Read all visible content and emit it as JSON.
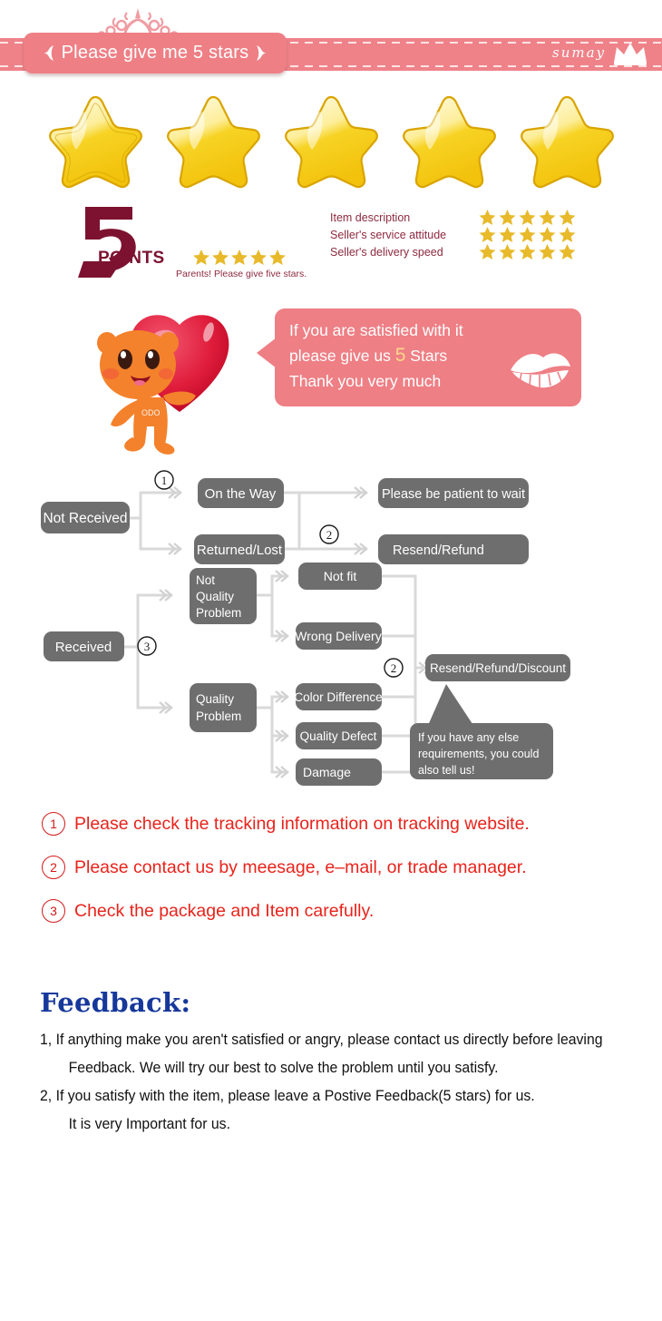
{
  "header": {
    "banner_title": "Please give me 5 stars",
    "brand_name": "sumay",
    "crown_icon": "crown-deco-icon",
    "left_ornament_icon": "ornament-icon",
    "right_ornament_icon": "ornament-icon",
    "brand_crown_icon": "crown-icon",
    "banner_color": "#ef8289",
    "plate_color": "#ee7f85"
  },
  "big_stars": {
    "count": 5,
    "star_icon": "gold-star-icon",
    "color": "#f5cf1e"
  },
  "points": {
    "number": "5",
    "label": "POINTS",
    "subtitle": "Parents! Please give five stars.",
    "star_count": 5,
    "color": "#7d1230",
    "star_color": "#e8b92a"
  },
  "rating_rows": [
    {
      "name": "Item description",
      "stars": 5
    },
    {
      "name": "Seller's service attitude",
      "stars": 5
    },
    {
      "name": "Seller's delivery speed",
      "stars": 5
    }
  ],
  "promo": {
    "mascot_icon": "mascot-holding-heart-icon",
    "heart_icon": "heart-icon",
    "lips_icon": "lips-kiss-icon",
    "line1": "If you are satisfied with it",
    "line2_a": "please give us ",
    "line2_hl": "5",
    "line2_b": " Stars",
    "line3": "Thank you very much",
    "bubble_color": "#ee7f85",
    "highlight_color": "#ffd98a"
  },
  "flow": {
    "box_color": "#6e6e6e",
    "line_color": "#d6d6d6",
    "nodes": {
      "not_received": "Not Received",
      "on_the_way": "On the Way",
      "returned_lost": "Returned/Lost",
      "please_wait": "Please be patient to wait",
      "resend_refund": "Resend/Refund",
      "received": "Received",
      "not_quality_problem": "Not\nQuality\nProblem",
      "not_quality_l1": "Not",
      "not_quality_l2": "Quality",
      "not_quality_l3": "Problem",
      "quality_problem_l1": "Quality",
      "quality_problem_l2": "Problem",
      "not_fit": "Not fit",
      "wrong_delivery": "Wrong Delivery",
      "color_difference": "Color Difference",
      "quality_defect": "Quality Defect",
      "damage": "Damage",
      "resend_refund_discount": "Resend/Refund/Discount"
    },
    "markers": {
      "one": "①",
      "two": "②",
      "three": "③"
    },
    "callout": {
      "line1": "If you have any else",
      "line2": "requirements, you could",
      "line3": "also tell us!"
    }
  },
  "notes": [
    {
      "num": "①",
      "text": "Please check the tracking information on tracking website."
    },
    {
      "num": "②",
      "text": "Please contact us by meesage, e–mail, or trade manager."
    },
    {
      "num": "③",
      "text": "Check the package and Item carefully."
    }
  ],
  "feedback": {
    "title": "Feedback:",
    "lines": [
      "1, If anything make you aren't satisfied or angry, please contact us directly before leaving",
      "Feedback. We will try our best to solve the problem until you satisfy.",
      "2, If you satisfy with the item, please leave a Postive Feedback(5 stars) for us.",
      "It is very Important for us."
    ],
    "title_color": "#16389b"
  }
}
